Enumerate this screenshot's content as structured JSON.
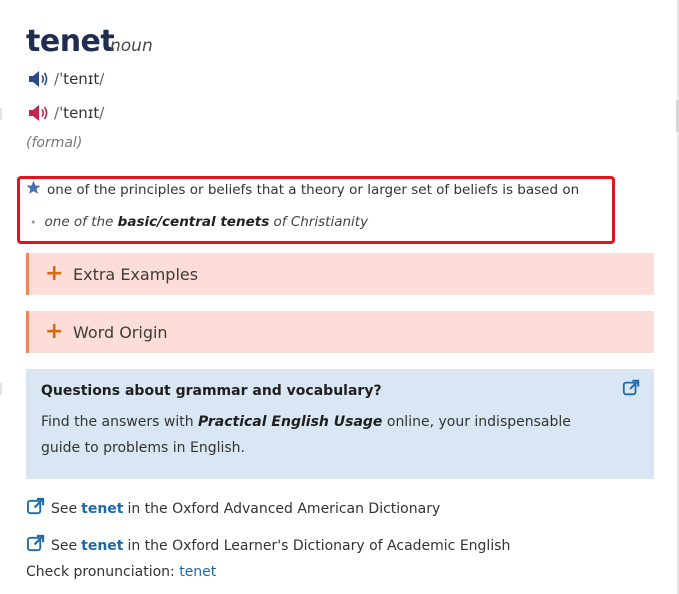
{
  "entry": {
    "headword": "tenet",
    "pos": "noun",
    "pronunciations": [
      {
        "variant": "us",
        "icon": "speaker-icon",
        "color": "#2b4a8b",
        "ipa": "ˈtenɪt"
      },
      {
        "variant": "uk",
        "icon": "speaker-icon",
        "color": "#c8234d",
        "ipa": "ˈtenɪt"
      }
    ],
    "register": "(formal)"
  },
  "sense": {
    "icon": "star-icon",
    "definition": "one of the principles or beliefs that a theory or larger set of beliefs is based on",
    "example": {
      "pre": "one of the ",
      "collocation": "basic/central tenets",
      "post": " of Christianity"
    }
  },
  "sections": [
    {
      "label": "Extra Examples"
    },
    {
      "label": "Word Origin"
    }
  ],
  "peu": {
    "title": "Questions about grammar and vocabulary?",
    "body_pre": "Find the answers with ",
    "body_bold": "Practical English Usage",
    "body_post": " online, your indispensable guide to problems in English."
  },
  "xrefs": [
    {
      "pre": "See",
      "link": "tenet",
      "post": "in the Oxford Advanced American Dictionary"
    },
    {
      "pre": "See",
      "link": "tenet",
      "post": "in the Oxford Learner's Dictionary of Academic English"
    }
  ],
  "check_pronunciation": {
    "label": "Check pronunciation:",
    "link": "tenet"
  },
  "colors": {
    "red_frame": "#e0141e",
    "accent_orange": "#f28460",
    "link_blue": "#1f6aa8",
    "box_blue": "#d8e7f3"
  }
}
